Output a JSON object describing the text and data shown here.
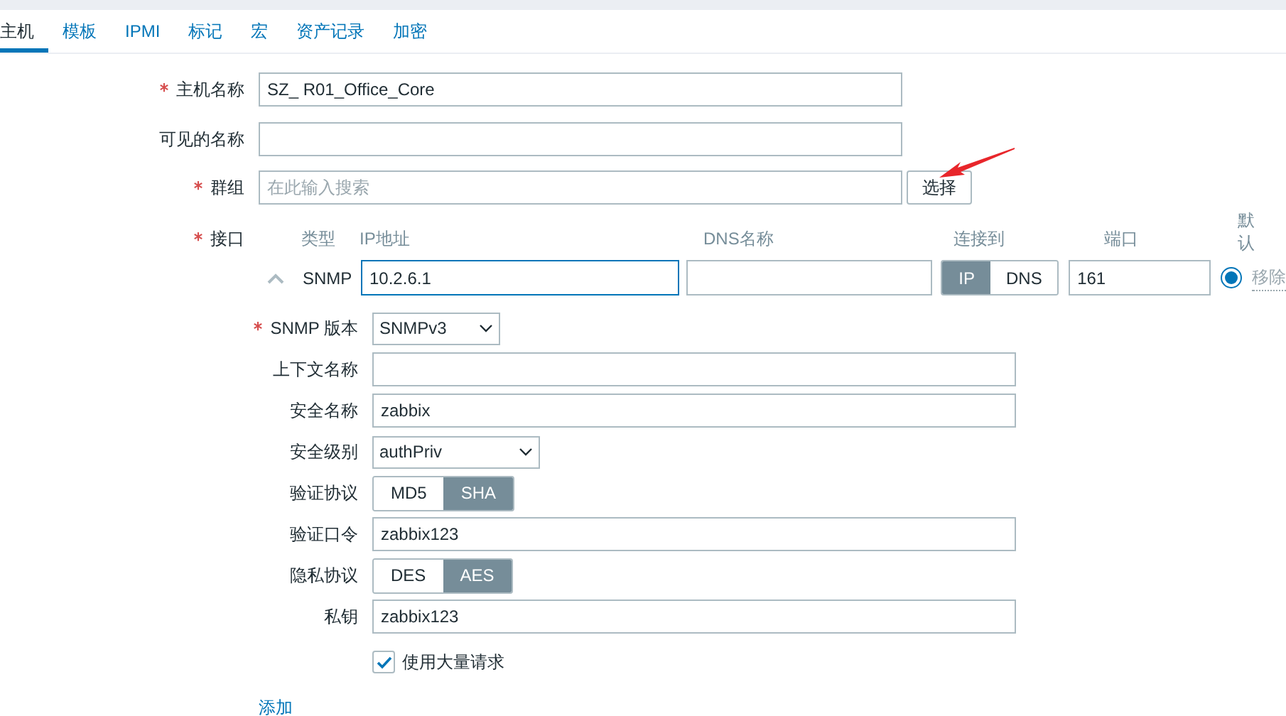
{
  "tabs": [
    {
      "label": "主机",
      "selected": true
    },
    {
      "label": "模板",
      "selected": false
    },
    {
      "label": "IPMI",
      "selected": false
    },
    {
      "label": "标记",
      "selected": false
    },
    {
      "label": "宏",
      "selected": false
    },
    {
      "label": "资产记录",
      "selected": false
    },
    {
      "label": "加密",
      "selected": false
    }
  ],
  "host_name": {
    "label": "主机名称",
    "required": true,
    "value": "SZ_ R01_Office_Core"
  },
  "visible_name": {
    "label": "可见的名称",
    "required": false
  },
  "groups": {
    "label": "群组",
    "required": true,
    "placeholder": "在此输入搜索",
    "button": "选择"
  },
  "interfaces": {
    "label": "接口",
    "required": true,
    "columns": [
      "类型",
      "IP地址",
      "DNS名称",
      "连接到",
      "端口",
      "默认"
    ],
    "rows": [
      {
        "type": "SNMP",
        "expanded": true,
        "ip": "10.2.6.1",
        "ip_focused": true,
        "connect": [
          {
            "label": "IP",
            "selected": true
          },
          {
            "label": "DNS",
            "selected": false
          }
        ],
        "port": "161",
        "default": true,
        "remove": "移除"
      }
    ]
  },
  "snmp": [
    {
      "kind": "select",
      "label": "SNMP 版本",
      "required": true,
      "value": "SNMPv3"
    },
    {
      "kind": "text",
      "label": "上下文名称",
      "required": false
    },
    {
      "kind": "text",
      "label": "安全名称",
      "required": false,
      "value": "zabbix"
    },
    {
      "kind": "select",
      "label": "安全级别",
      "required": false,
      "value": "authPriv"
    },
    {
      "kind": "toggle",
      "label": "验证协议",
      "required": false,
      "options": [
        {
          "label": "MD5",
          "selected": false
        },
        {
          "label": "SHA",
          "selected": true
        }
      ]
    },
    {
      "kind": "text",
      "label": "验证口令",
      "required": false,
      "value": "zabbix123"
    },
    {
      "kind": "toggle",
      "label": "隐私协议",
      "required": false,
      "options": [
        {
          "label": "DES",
          "selected": false
        },
        {
          "label": "AES",
          "selected": true
        }
      ]
    },
    {
      "kind": "text",
      "label": "私钥",
      "required": false,
      "value": "zabbix123"
    },
    {
      "kind": "checkbox",
      "label": "使用大量请求",
      "checked": true
    }
  ],
  "add_link": "添加",
  "annotation": {
    "kind": "arrow"
  }
}
